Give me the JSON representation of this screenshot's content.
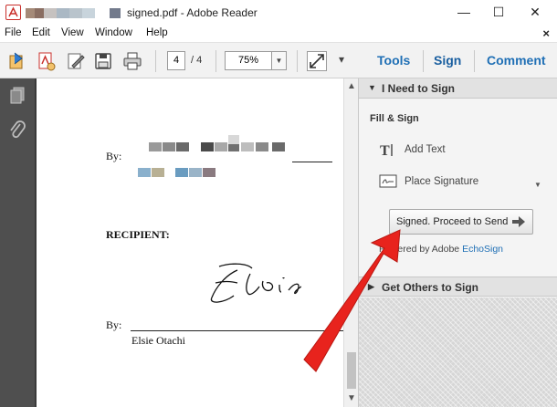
{
  "window": {
    "title": "signed.pdf - Adobe Reader",
    "minimize_label": "—",
    "maximize_label": "☐",
    "close_label": "✕"
  },
  "menu": {
    "items": [
      "File",
      "Edit",
      "View",
      "Window",
      "Help"
    ],
    "close_label": "×"
  },
  "toolbar": {
    "page_current": "4",
    "page_total": "/ 4",
    "zoom": "75%",
    "zoom_dropdown": "▼",
    "more_dropdown": "▾",
    "tools_label": "Tools",
    "sign_label": "Sign",
    "comment_label": "Comment"
  },
  "document": {
    "by_label_1": "By:",
    "recipient_label": "RECIPIENT:",
    "by_label_2": "By:",
    "signer_name": "Elsie Otachi",
    "signature_script": "Elsie"
  },
  "panel": {
    "section1_title": "I Need to Sign",
    "section1_toggle": "▼",
    "fill_sign_label": "Fill & Sign",
    "add_text_label": "Add Text",
    "place_signature_label": "Place Signature",
    "place_signature_dropdown": "▼",
    "proceed_button_label": "Signed. Proceed to Send",
    "powered_prefix": "Powered by Adobe ",
    "powered_link": "EchoSign",
    "section2_title": "Get Others to Sign",
    "section2_toggle": "▶"
  },
  "scrollbar": {
    "up_arrow": "▲",
    "down_arrow": "▼"
  },
  "colors": {
    "accent_blue": "#1f6fb5",
    "nav_dark": "#4f4f4f",
    "annotation_red": "#e8231d"
  }
}
